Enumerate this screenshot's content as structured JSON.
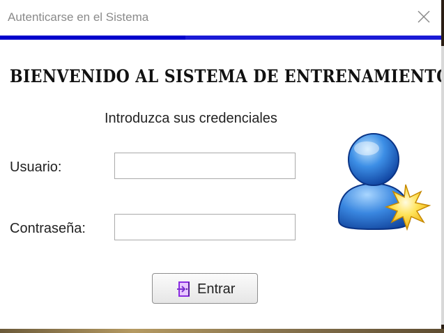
{
  "window": {
    "title": "Autenticarse en el Sistema"
  },
  "progress": {
    "fraction": 0.42,
    "color": "#0000cc"
  },
  "header": {
    "welcome": "BIENVENIDO AL SISTEMA DE ENTRENAMIENTO"
  },
  "form": {
    "subtitle": "Introduzca sus credenciales",
    "username_label": "Usuario:",
    "username_value": "",
    "password_label": "Contraseña:",
    "password_value": ""
  },
  "actions": {
    "enter_label": "Entrar",
    "enter_icon": "door-enter-icon"
  },
  "icons": {
    "avatar": "user-star-icon",
    "close": "close-icon"
  }
}
